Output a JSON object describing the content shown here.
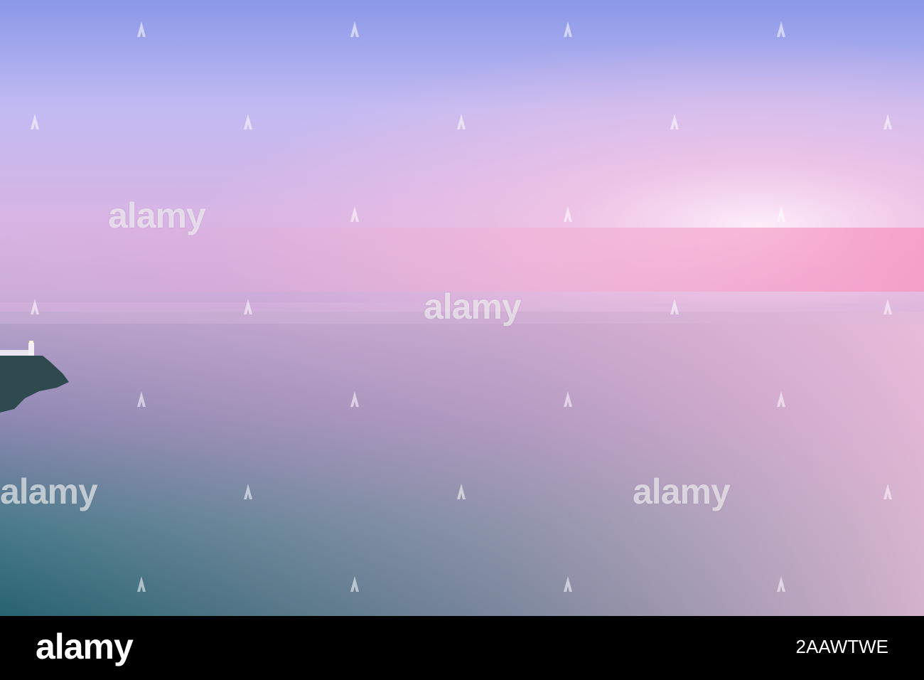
{
  "scene": {
    "description_colors": {
      "sky_top": "#8f9ceb",
      "sky_mid": "#d8c8f5",
      "sky_glow": "#f4c0df",
      "horizon": "#c7a7d3",
      "sea_far": "#b79fc8",
      "sea_near": "#2f6b79",
      "sea_right": "#dcaed0"
    }
  },
  "watermark": {
    "text": "alamy"
  },
  "footer": {
    "logo": "alamy",
    "image_id": "2AAWTWE"
  }
}
